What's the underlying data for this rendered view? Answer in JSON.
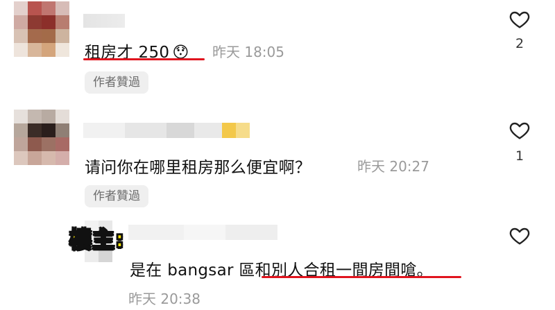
{
  "comments": [
    {
      "text": "租房才 250",
      "emoji": "😯",
      "time": "昨天 18:05",
      "badge": "作者贊過",
      "likes": "2"
    },
    {
      "text": "请问你在哪里租房那么便宜啊？",
      "time": "昨天 20:27",
      "badge": "作者贊過",
      "likes": "1"
    },
    {
      "op_label": "樓主:",
      "text_plain": "是在 bangsar 區",
      "text_highlight": "和別人合租一間房間嗆",
      "text_end": "。",
      "time": "昨天 20:38"
    }
  ],
  "colors": {
    "underline": "#e0141e",
    "op_label": "#ffe600",
    "time": "#9a9a9a",
    "chip_bg": "#efefef"
  },
  "icons": [
    "heart-outline-icon",
    "blurred-avatar",
    "blurred-username"
  ]
}
